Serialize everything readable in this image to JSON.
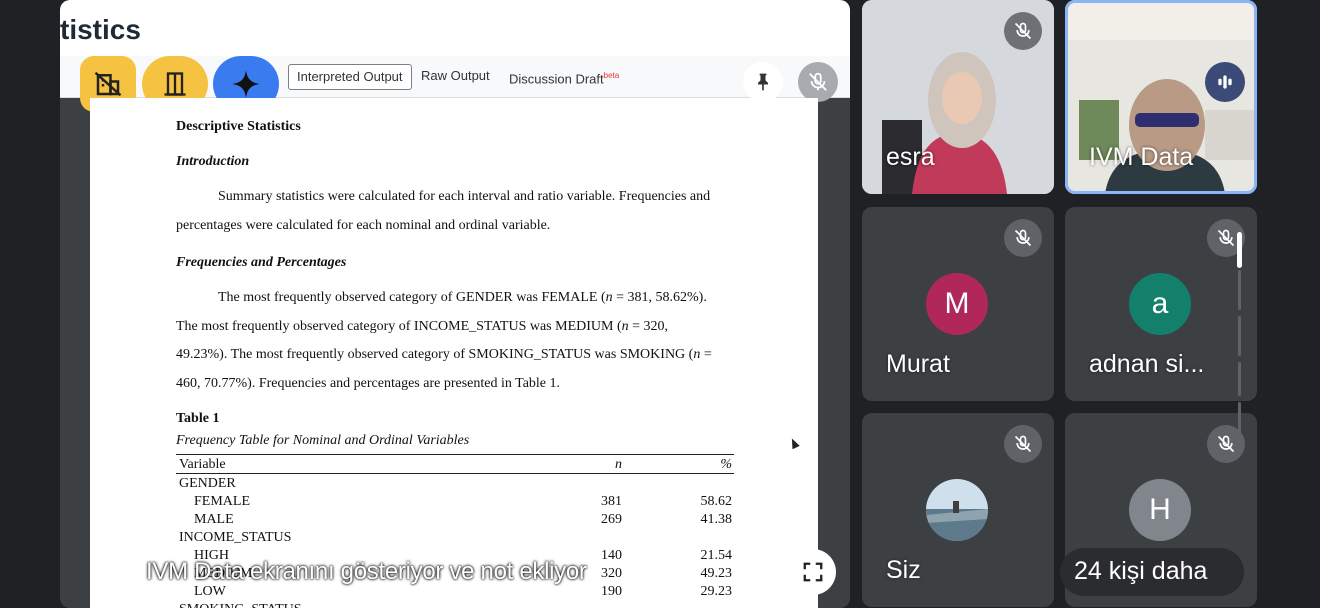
{
  "screen_share": {
    "app_title": "tistics",
    "tabs": [
      {
        "label": "Interpreted Output",
        "active": true
      },
      {
        "label": "Raw Output",
        "active": false
      },
      {
        "label": "Discussion Draft",
        "badge": "beta",
        "active": false
      }
    ],
    "overlay_caption": "IVM Data ekranını gösteriyor ve not ekliyor",
    "icons": {
      "pin": "pin-icon",
      "mute": "mic-off-icon",
      "fullscreen": "fullscreen-icon",
      "ai": "sparkle-icon"
    }
  },
  "document": {
    "heading": "Descriptive Statistics",
    "intro_heading": "Introduction",
    "intro_lines": [
      "Summary statistics were calculated for each interval and ratio variable. Frequencies and",
      "percentages were calculated for each nominal and ordinal variable."
    ],
    "freq_heading": "Frequencies and Percentages",
    "freq_lines": [
      {
        "pre": "The most frequently observed category of GENDER was FEMALE (",
        "n": "n",
        "post": " = 381, 58.62%)."
      },
      {
        "pre": "The most frequently observed category of INCOME_STATUS was MEDIUM (",
        "n": "n",
        "post": " = 320,"
      },
      {
        "pre": "49.23%). The most frequently observed category of SMOKING_STATUS was SMOKING (",
        "n": "n",
        "post": " ="
      },
      {
        "pre": "460, 70.77%). Frequencies and percentages are presented in Table 1.",
        "n": "",
        "post": ""
      }
    ],
    "table_label": "Table 1",
    "table_caption": "Frequency Table for Nominal and Ordinal Variables",
    "table_headers": [
      "Variable",
      "n",
      "%"
    ],
    "table_rows": [
      {
        "label": "GENDER",
        "n": "",
        "pct": "",
        "sub": false
      },
      {
        "label": "FEMALE",
        "n": "381",
        "pct": "58.62",
        "sub": true
      },
      {
        "label": "MALE",
        "n": "269",
        "pct": "41.38",
        "sub": true
      },
      {
        "label": "INCOME_STATUS",
        "n": "",
        "pct": "",
        "sub": false
      },
      {
        "label": "HIGH",
        "n": "140",
        "pct": "21.54",
        "sub": true
      },
      {
        "label": "MEDIUM",
        "n": "320",
        "pct": "49.23",
        "sub": true
      },
      {
        "label": "LOW",
        "n": "190",
        "pct": "29.23",
        "sub": true
      },
      {
        "label": "SMOKING_STATUS",
        "n": "",
        "pct": "",
        "sub": false
      }
    ]
  },
  "participants": [
    {
      "name": "esra",
      "muted": true,
      "video": true
    },
    {
      "name": "IVM Data",
      "muted": false,
      "speaking": true,
      "video": true
    },
    {
      "name": "Murat",
      "initial": "M",
      "muted": true,
      "avatar_color": "#b0275a"
    },
    {
      "name": "adnan si...",
      "initial": "a",
      "muted": true,
      "avatar_color": "#12806a"
    },
    {
      "name": "Siz",
      "muted": true,
      "avatar_image": true
    },
    {
      "name": "",
      "initial": "H",
      "muted": true,
      "avatar_color": "#80868b"
    }
  ],
  "more_participants": "24 kişi daha",
  "colors": {
    "speaking_outline": "#8ab4f8",
    "tile_bg": "#3c4043",
    "app_yellow": "#f5c242",
    "app_blue": "#3a7bf0"
  }
}
